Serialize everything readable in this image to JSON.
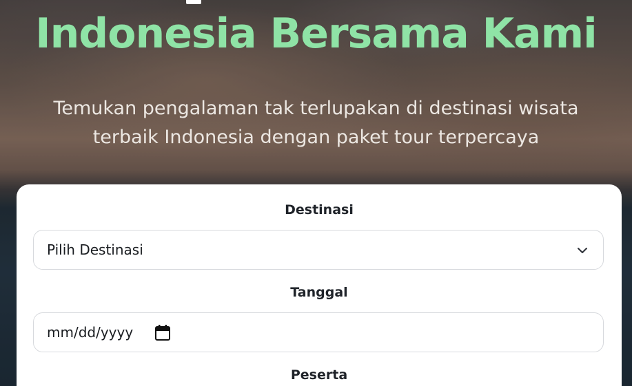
{
  "hero": {
    "title": "Indonesia Bersama Kami",
    "subtitle": "Temukan pengalaman tak terlupakan di destinasi wisata terbaik Indonesia dengan paket tour terpercaya"
  },
  "form": {
    "destination": {
      "label": "Destinasi",
      "selected": "Pilih Destinasi"
    },
    "date": {
      "label": "Tanggal",
      "placeholder": "mm/dd/yyyy"
    },
    "participants": {
      "label": "Peserta"
    }
  },
  "icons": {
    "destination_dropdown": "chevron-down-icon",
    "date_picker": "calendar-icon"
  },
  "colors": {
    "title": "#8fe3a6",
    "subtitle": "#ece7e2",
    "card": "#ffffff"
  }
}
